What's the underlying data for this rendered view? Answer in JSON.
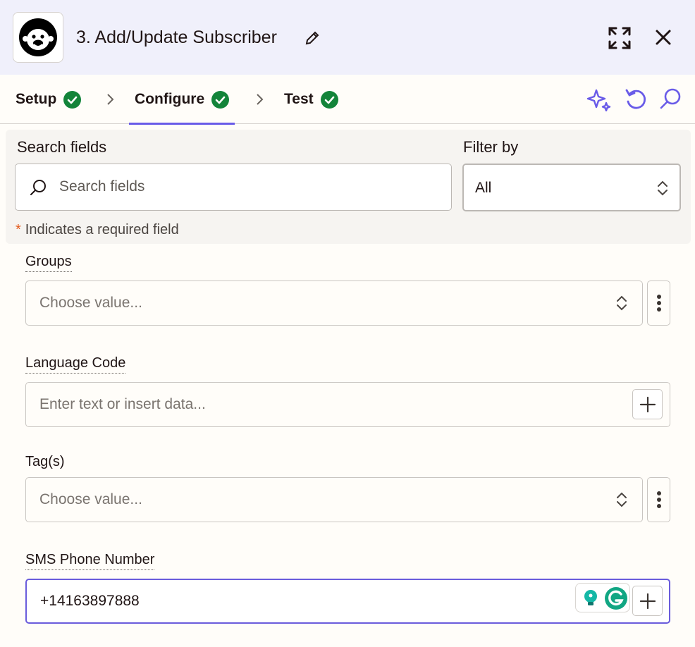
{
  "header": {
    "title": "3. Add/Update Subscriber",
    "app_logo_icon": "mailchimp-logo",
    "edit_icon": "pencil-icon",
    "expand_icon": "expand-icon",
    "close_icon": "close-icon"
  },
  "tabs": [
    {
      "label": "Setup",
      "status": "complete",
      "active": false
    },
    {
      "label": "Configure",
      "status": "complete",
      "active": true
    },
    {
      "label": "Test",
      "status": "complete",
      "active": false
    }
  ],
  "toolbar": {
    "icons": [
      "sparkle-icon",
      "undo-icon",
      "search-icon"
    ],
    "accent_color": "#695be8"
  },
  "search_panel": {
    "search_label": "Search fields",
    "search_placeholder": "Search fields",
    "filter_label": "Filter by",
    "filter_value": "All",
    "required_star": "*",
    "required_note": "Indicates a required field"
  },
  "fields": [
    {
      "label": "Groups",
      "placeholder": "Choose value...",
      "kind": "select"
    },
    {
      "label": "Language Code",
      "placeholder": "Enter text or insert data...",
      "kind": "text"
    },
    {
      "label": "Tag(s)",
      "placeholder": "Choose value...",
      "kind": "select"
    },
    {
      "label": "SMS Phone Number",
      "value": "+14163897888",
      "kind": "text"
    }
  ],
  "colors": {
    "check_green": "#13843a",
    "required_star": "#e35b1d",
    "focus_border": "#6a5cdc",
    "header_bg": "#f0f0fb"
  }
}
